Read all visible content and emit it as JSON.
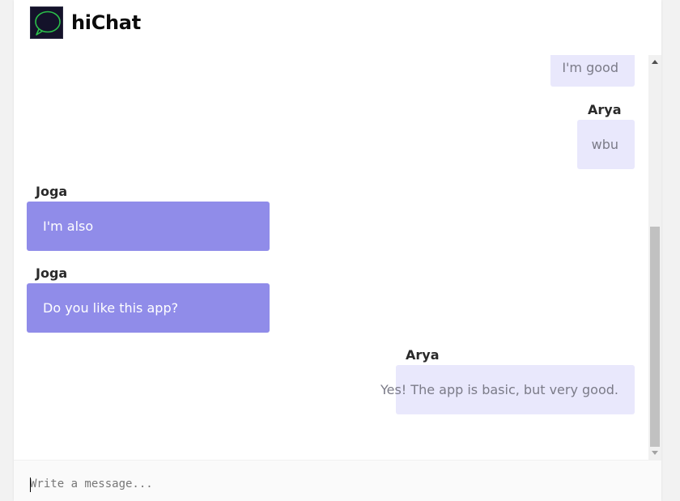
{
  "app": {
    "title": "hiChat",
    "logo_icon": "chat-bubble-icon"
  },
  "messages": [
    {
      "author": "",
      "text": "I'm good",
      "mine": true
    },
    {
      "author": "Arya",
      "text": "wbu",
      "mine": true
    },
    {
      "author": "Joga",
      "text": "I'm also",
      "mine": false
    },
    {
      "author": "Joga",
      "text": "Do you like this app?",
      "mine": false
    },
    {
      "author": "Arya",
      "text": "Yes! The app is basic, but very good.",
      "mine": true
    }
  ],
  "composer": {
    "placeholder": "Write a message..."
  },
  "colors": {
    "own_bubble": "#e9e8fc",
    "other_bubble": "#908ce9",
    "logo_bg": "#14122a",
    "logo_stroke": "#2bbf4a"
  }
}
